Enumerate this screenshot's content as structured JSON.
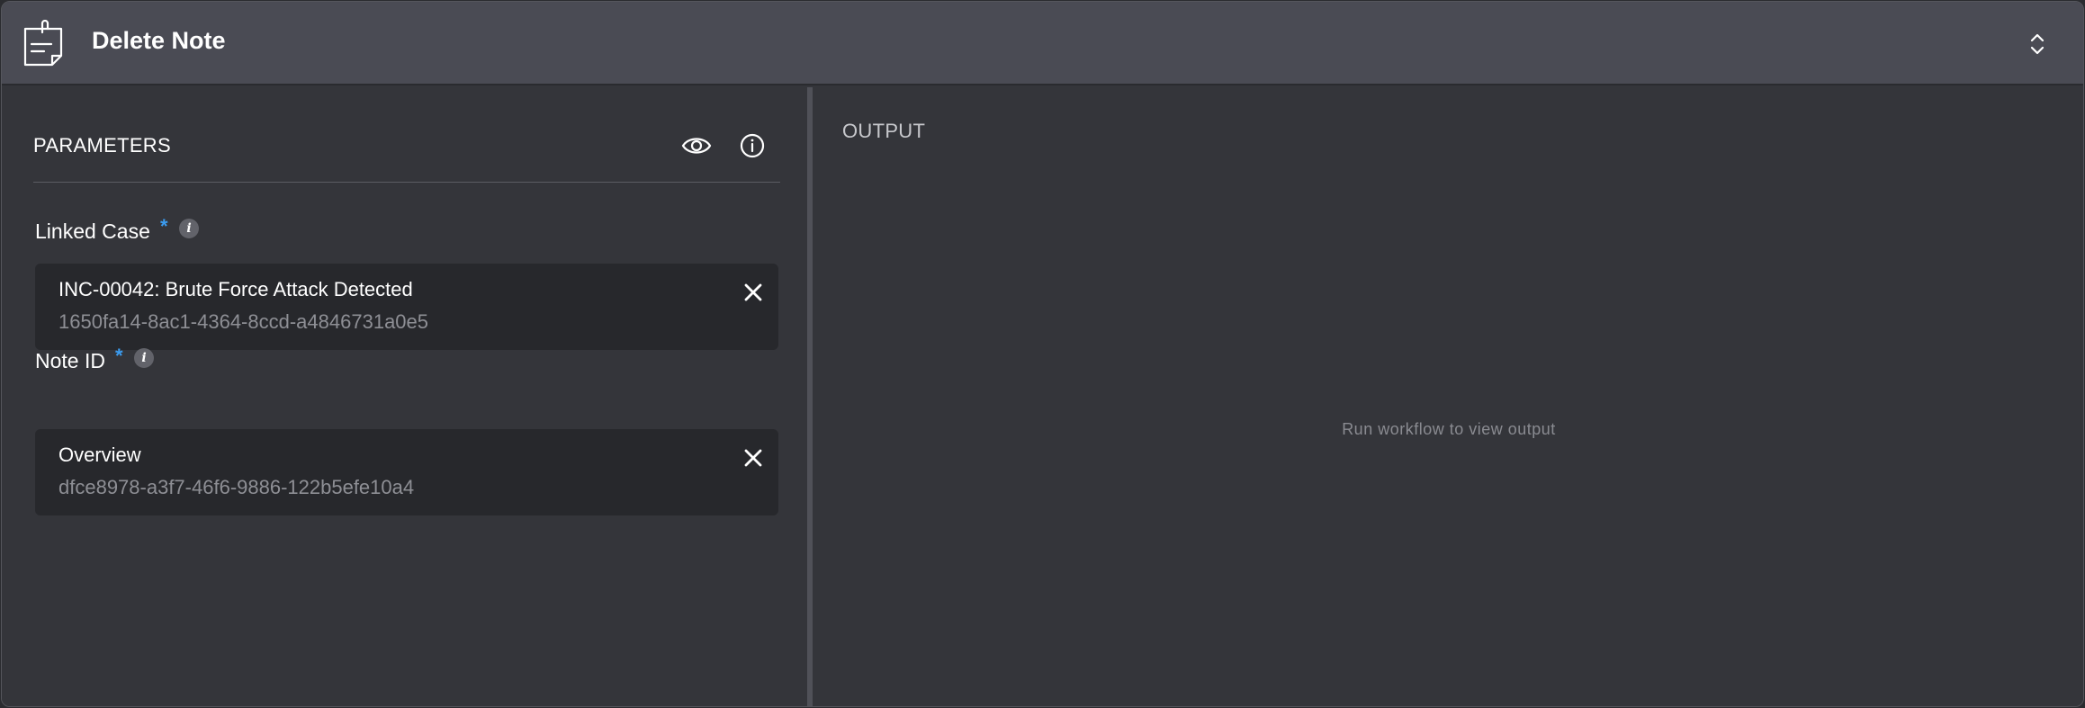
{
  "header": {
    "title": "Delete Note",
    "app_icon": "sticky-note-icon",
    "collapse_icon": "chevron-up-down-icon"
  },
  "parameters": {
    "title": "PARAMETERS",
    "preview_icon": "eye-icon",
    "info_icon": "info-circle-icon",
    "fields": [
      {
        "label": "Linked Case",
        "required_marker": "*",
        "info_marker": "i",
        "value_title": "INC-00042: Brute Force Attack Detected",
        "value_id": "1650fa14-8ac1-4364-8ccd-a4846731a0e5"
      },
      {
        "label": "Note ID",
        "required_marker": "*",
        "info_marker": "i",
        "value_title": "Overview",
        "value_id": "dfce8978-a3f7-46f6-9886-122b5efe10a4"
      }
    ]
  },
  "output": {
    "title": "OUTPUT",
    "empty_message": "Run workflow to view output"
  },
  "colors": {
    "header_bg": "#4a4b54",
    "panel_bg": "#34353a",
    "chip_bg": "#27282c",
    "required_accent": "#3b9cf0"
  }
}
